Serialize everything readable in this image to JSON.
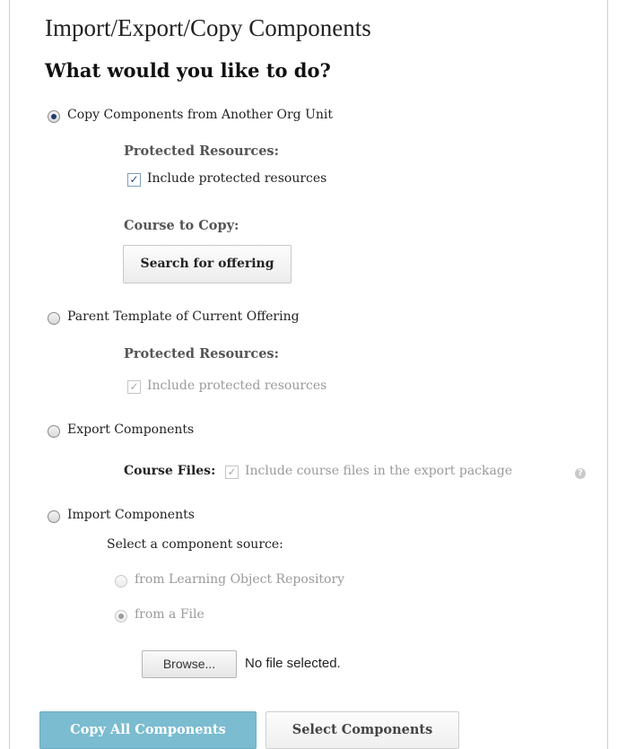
{
  "page": {
    "title": "Import/Export/Copy Components",
    "question": "What would you like to do?"
  },
  "options": {
    "copy": {
      "label": "Copy Components from Another Org Unit",
      "selected": true,
      "protected_heading": "Protected Resources:",
      "protected_checkbox_label": "Include protected resources",
      "protected_checked": true,
      "course_heading": "Course to Copy:",
      "search_button": "Search for offering"
    },
    "parent": {
      "label": "Parent Template of Current Offering",
      "selected": false,
      "protected_heading": "Protected Resources:",
      "protected_checkbox_label": "Include protected resources",
      "protected_checked": true,
      "disabled": true
    },
    "export": {
      "label": "Export Components",
      "selected": false,
      "course_files_label": "Course Files:",
      "course_files_checkbox_label": "Include course files in the export package",
      "course_files_checked": true,
      "help_icon": "help-icon"
    },
    "import": {
      "label": "Import Components",
      "selected": false,
      "source_heading": "Select a component source:",
      "sources": [
        {
          "label": "from Learning Object Repository",
          "selected": false
        },
        {
          "label": "from a File",
          "selected": true
        }
      ],
      "browse_button": "Browse...",
      "file_status": "No file selected."
    }
  },
  "actions": {
    "copy_all": "Copy All Components",
    "select": "Select Components"
  },
  "colors": {
    "primary_button": "#7bbcd0",
    "disabled_text": "#9a9a9a",
    "heading_gray": "#555555"
  }
}
